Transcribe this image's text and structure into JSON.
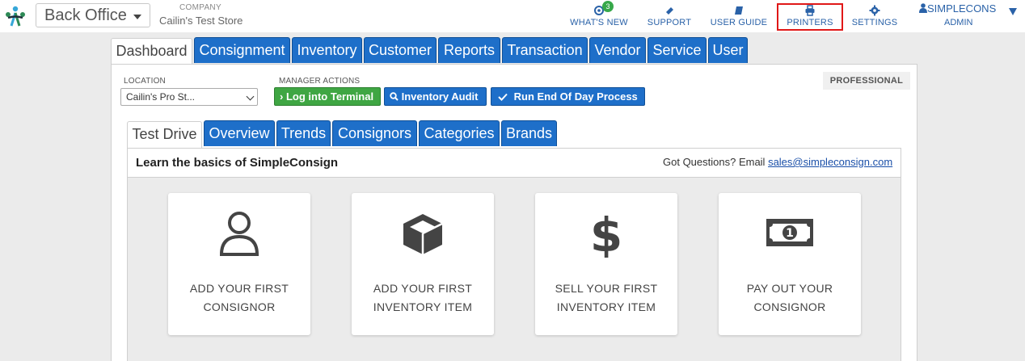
{
  "header": {
    "app_select": "Back Office",
    "company_caption": "COMPANY",
    "company_name": "Cailin's Test Store",
    "nav": [
      {
        "label": "WHAT'S NEW",
        "icon": "bullhorn-icon",
        "badge": "3"
      },
      {
        "label": "SUPPORT",
        "icon": "ticket-icon"
      },
      {
        "label": "USER GUIDE",
        "icon": "book-icon"
      },
      {
        "label": "PRINTERS",
        "icon": "printer-icon"
      },
      {
        "label": "SETTINGS",
        "icon": "gear-icon"
      }
    ],
    "user": {
      "name": "SIMPLECONS",
      "role": "ADMIN",
      "icon": "user-icon"
    }
  },
  "main_tabs": [
    "Dashboard",
    "Consignment",
    "Inventory",
    "Customer",
    "Reports",
    "Transaction",
    "Vendor",
    "Service",
    "User"
  ],
  "active_main_tab": "Dashboard",
  "toolbar": {
    "location_caption": "LOCATION",
    "location_value": "Cailin's Pro St...",
    "manager_caption": "MANAGER ACTIONS",
    "buttons": [
      {
        "label": "Log into Terminal",
        "icon": "chevron-right-icon",
        "color": "#3fa643"
      },
      {
        "label": "Inventory Audit",
        "icon": "search-icon",
        "color": "#1e6fc9"
      },
      {
        "label": "Run End Of Day Process",
        "icon": "check-icon",
        "color": "#1e6fc9"
      }
    ],
    "plan_badge": "PROFESSIONAL"
  },
  "sub_tabs": [
    "Test Drive",
    "Overview",
    "Trends",
    "Consignors",
    "Categories",
    "Brands"
  ],
  "active_sub_tab": "Test Drive",
  "test_drive": {
    "title": "Learn the basics of SimpleConsign",
    "questions_text": "Got Questions? Email ",
    "email": "sales@simpleconsign.com",
    "cards": [
      {
        "line1": "ADD YOUR FIRST",
        "line2": "CONSIGNOR",
        "icon": "user-outline-icon"
      },
      {
        "line1": "ADD YOUR FIRST",
        "line2": "INVENTORY ITEM",
        "icon": "box-icon"
      },
      {
        "line1": "SELL YOUR FIRST",
        "line2": "INVENTORY ITEM",
        "icon": "dollar-icon"
      },
      {
        "line1": "PAY OUT YOUR",
        "line2": "CONSIGNOR",
        "icon": "money-bill-icon"
      }
    ]
  },
  "colors": {
    "accent": "#1e6fc9",
    "success": "#3fa643",
    "highlight": "#e01818"
  }
}
